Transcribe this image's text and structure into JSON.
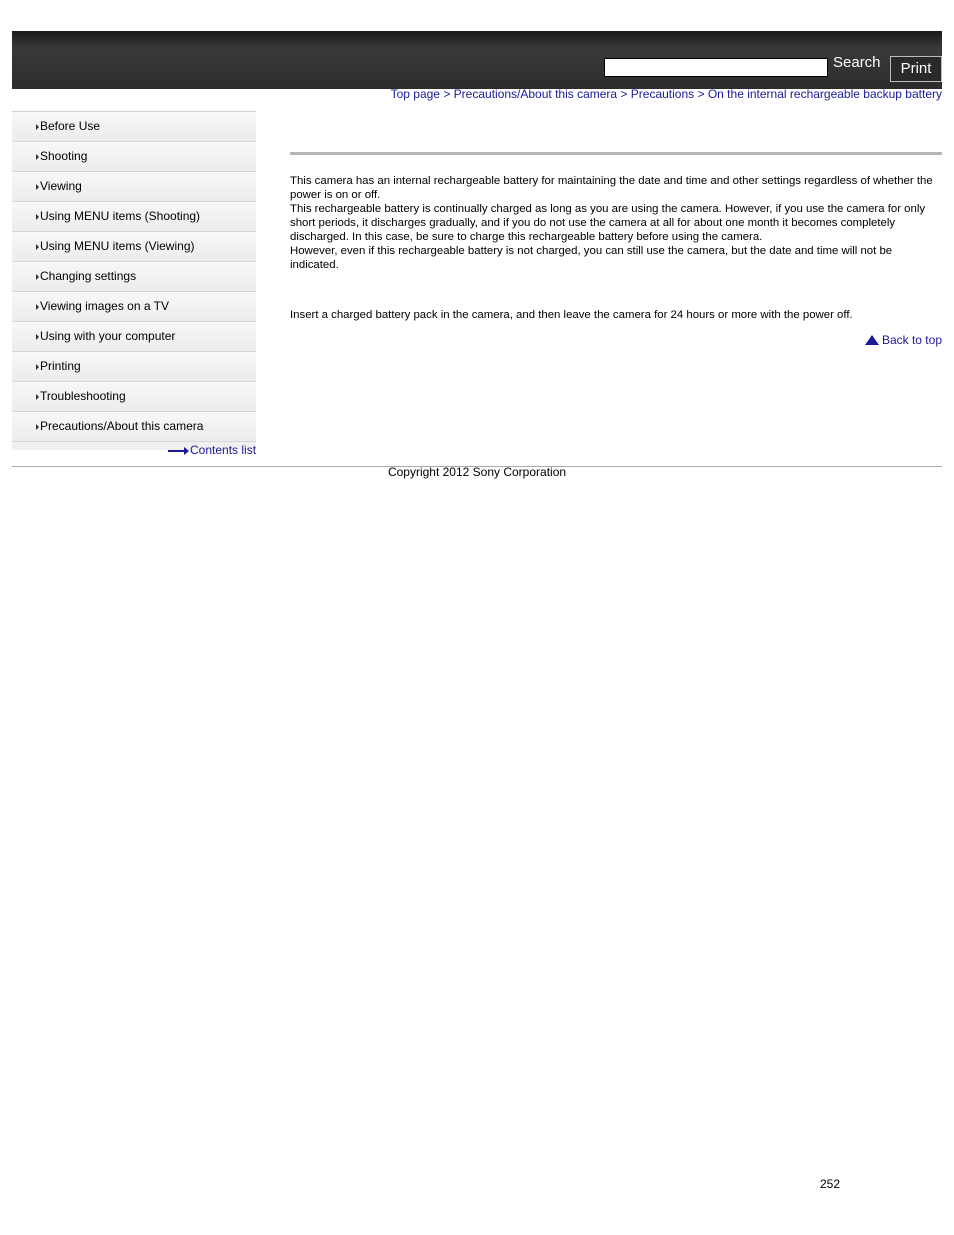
{
  "header": {
    "search_placeholder": "",
    "search_label": "Search",
    "print_label": "Print"
  },
  "breadcrumb": {
    "items": [
      "Top page",
      "Precautions/About this camera",
      "Precautions",
      "On the internal rechargeable backup battery"
    ],
    "separator": " > "
  },
  "sidebar": {
    "items": [
      {
        "label": "Before Use"
      },
      {
        "label": "Shooting"
      },
      {
        "label": "Viewing"
      },
      {
        "label": "Using MENU items (Shooting)"
      },
      {
        "label": "Using MENU items (Viewing)"
      },
      {
        "label": "Changing settings"
      },
      {
        "label": "Viewing images on a TV"
      },
      {
        "label": "Using with your computer"
      },
      {
        "label": "Printing"
      },
      {
        "label": "Troubleshooting"
      },
      {
        "label": "Precautions/About this camera"
      }
    ],
    "contents_link": "Contents list"
  },
  "main": {
    "paragraphs": [
      "This camera has an internal rechargeable battery for maintaining the date and time and other settings regardless of whether the power is on or off.",
      "This rechargeable battery is continually charged as long as you are using the camera. However, if you use the camera for only short periods, it discharges gradually, and if you do not use the camera at all for about one month it becomes completely discharged. In this case, be sure to charge this rechargeable battery before using the camera.",
      "However, even if this rechargeable battery is not charged, you can still use the camera, but the date and time will not be indicated."
    ],
    "charge_instruction": "Insert a charged battery pack in the camera, and then leave the camera for 24 hours or more with the power off.",
    "back_to_top": "Back to top"
  },
  "footer": {
    "copyright": "Copyright 2012 Sony Corporation",
    "page_number": "252"
  }
}
